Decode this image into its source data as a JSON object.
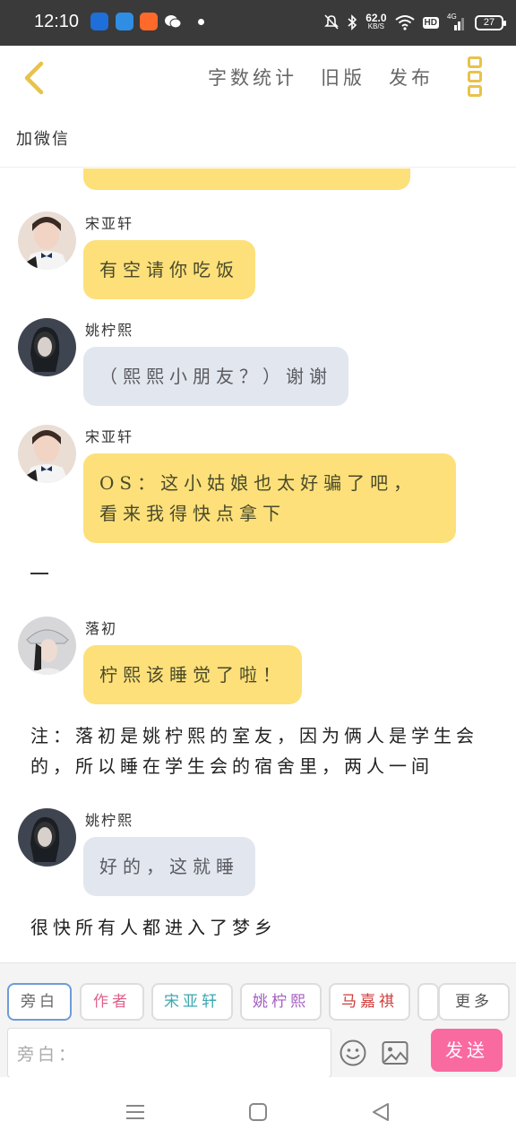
{
  "status_bar": {
    "time": "12:10",
    "net_speed_value": "62.0",
    "net_speed_unit": "KB/S",
    "hd_label": "HD",
    "signal_label": "4G",
    "battery": "27"
  },
  "header": {
    "back_icon": "chevron-left-icon",
    "actions": [
      "字数统计",
      "旧版",
      "发布"
    ],
    "menu_icon": "more-vertical-icon",
    "subtitle": "加微信"
  },
  "messages": [
    {
      "name": "宋亚轩",
      "text": "有空请你吃饭",
      "style": "yellow"
    },
    {
      "name": "姚柠熙",
      "text": "（熙熙小朋友？）谢谢",
      "style": "grey"
    },
    {
      "name": "宋亚轩",
      "text": "OS：这小姑娘也太好骗了吧，看来我得快点拿下",
      "style": "yellow"
    },
    {
      "name": "落初",
      "text": "柠熙该睡觉了啦！",
      "style": "yellow"
    },
    {
      "name": "姚柠熙",
      "text": "好的，这就睡",
      "style": "grey"
    }
  ],
  "narrations": [
    "注：落初是姚柠熙的室友，因为俩人是学生会的，所以睡在学生会的宿舍里，两人一间",
    "很快所有人都进入了梦乡"
  ],
  "roles": [
    {
      "label": "旁白",
      "color": "#666666"
    },
    {
      "label": "作者",
      "color": "#e0608a"
    },
    {
      "label": "宋亚轩",
      "color": "#3aa8b0"
    },
    {
      "label": "姚柠熙",
      "color": "#a45ec0"
    },
    {
      "label": "马嘉祺",
      "color": "#d03a3a"
    }
  ],
  "more_label": "更多",
  "input": {
    "placeholder": "旁白："
  },
  "send_label": "发送",
  "colors": {
    "yellow_bubble": "#fde07a",
    "grey_bubble": "#e2e7ef",
    "send_button": "#f96aa1",
    "accent_yellow": "#e8c24a"
  }
}
